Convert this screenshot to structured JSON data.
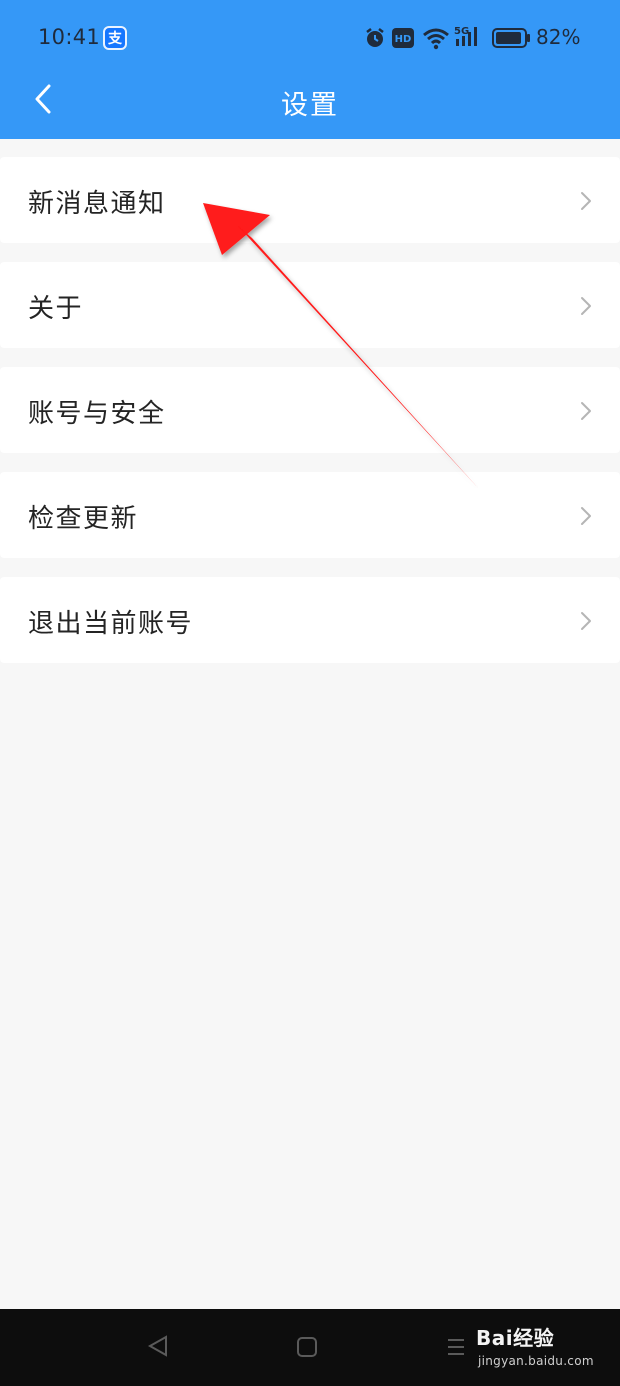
{
  "status_bar": {
    "time": "10:41",
    "app_icon": "支",
    "battery_percent": "82%",
    "icons": [
      "alarm-icon",
      "hd-icon",
      "wifi-icon",
      "5g-signal-icon",
      "battery-icon"
    ]
  },
  "header": {
    "title": "设置",
    "back_icon": "back-chevron-icon",
    "background_color": "#3598f7"
  },
  "menu": {
    "items": [
      {
        "label": "新消息通知"
      },
      {
        "label": "关于"
      },
      {
        "label": "账号与安全"
      },
      {
        "label": "检查更新"
      },
      {
        "label": "退出当前账号"
      }
    ]
  },
  "system_nav": {
    "buttons": [
      "back-triangle-icon",
      "home-square-icon",
      "menu-lines-icon"
    ],
    "watermark": "Bai经验",
    "watermark_url": "jingyan.baidu.com"
  },
  "annotation": {
    "color": "#ff1a1a"
  }
}
